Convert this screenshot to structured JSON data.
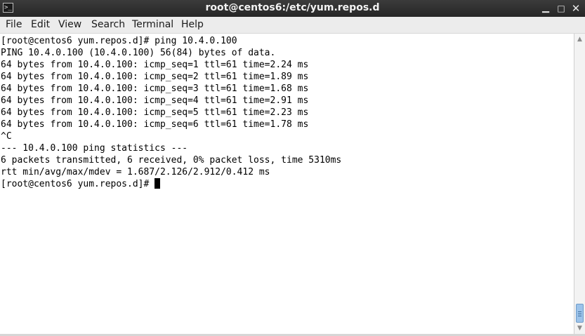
{
  "window": {
    "title": "root@centos6:/etc/yum.repos.d",
    "icon": "terminal-icon",
    "controls": {
      "minimize": "▁",
      "maximize": "□",
      "close": "✕"
    }
  },
  "menu": {
    "items": [
      "File",
      "Edit",
      "View",
      "Search",
      "Terminal",
      "Help"
    ]
  },
  "terminal": {
    "lines": [
      "[root@centos6 yum.repos.d]# ping 10.4.0.100",
      "PING 10.4.0.100 (10.4.0.100) 56(84) bytes of data.",
      "64 bytes from 10.4.0.100: icmp_seq=1 ttl=61 time=2.24 ms",
      "64 bytes from 10.4.0.100: icmp_seq=2 ttl=61 time=1.89 ms",
      "64 bytes from 10.4.0.100: icmp_seq=3 ttl=61 time=1.68 ms",
      "64 bytes from 10.4.0.100: icmp_seq=4 ttl=61 time=2.91 ms",
      "64 bytes from 10.4.0.100: icmp_seq=5 ttl=61 time=2.23 ms",
      "64 bytes from 10.4.0.100: icmp_seq=6 ttl=61 time=1.78 ms",
      "^C",
      "--- 10.4.0.100 ping statistics ---",
      "6 packets transmitted, 6 received, 0% packet loss, time 5310ms",
      "rtt min/avg/max/mdev = 1.687/2.126/2.912/0.412 ms"
    ],
    "prompt": "[root@centos6 yum.repos.d]# "
  },
  "scrollbar": {
    "position": 1.0
  },
  "colors": {
    "titlebar": "#2e2e2e",
    "menubar": "#ececec",
    "terminal_bg": "#ffffff",
    "terminal_fg": "#000000",
    "scroll_thumb": "#9cc3ea"
  }
}
